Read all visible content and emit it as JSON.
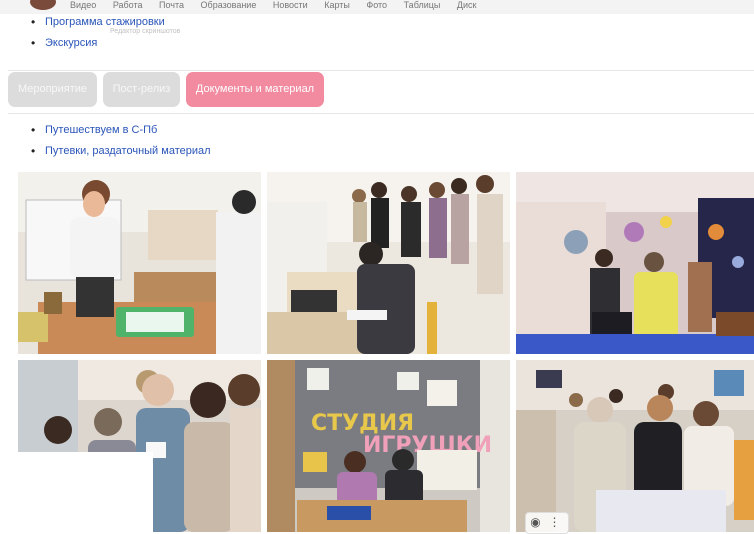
{
  "bookmarks": [
    "Видео",
    "Работа",
    "Почта",
    "Образование",
    "Новости",
    "Карты",
    "Фото",
    "Таблицы",
    "Диск"
  ],
  "links_top": [
    {
      "label": "Программа стажировки"
    },
    {
      "label": "Экскурсия"
    }
  ],
  "editor_hint": "Редактор скриншотов",
  "tabs": [
    {
      "label": "Мероприятие",
      "active": false
    },
    {
      "label": "Пост-релиз",
      "active": false
    },
    {
      "label": "Документы и материал",
      "active": true
    }
  ],
  "links_mid": [
    {
      "label": "Путешествуем в С-Пб"
    },
    {
      "label": "Путевки, раздаточный материал"
    }
  ],
  "photo_signs": {
    "studio": [
      "СТУДИЯ",
      "ИГРУШКИ"
    ]
  },
  "photo_toolbar": {
    "camera": "camera-icon",
    "more": "more-vertical-icon"
  },
  "colors": {
    "link": "#2a55b8",
    "tab_active": "#f28aa0",
    "tab_inactive": "#dcdcdc"
  }
}
